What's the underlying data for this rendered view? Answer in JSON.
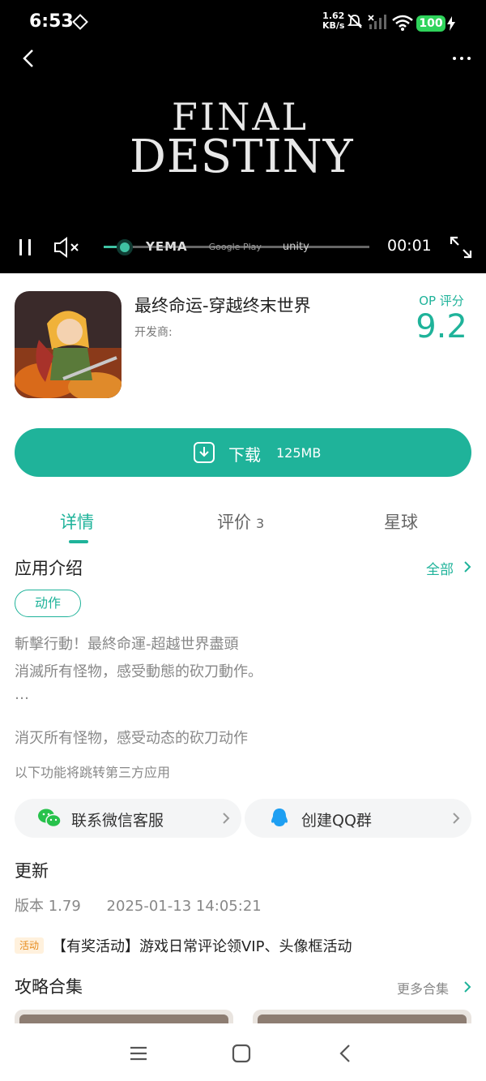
{
  "status_bar": {
    "time": "6:53",
    "net_speed_value": "1.62",
    "net_speed_unit": "KB/s",
    "battery": "100"
  },
  "video": {
    "logo_line1": "FINAL",
    "logo_line2": "DESTINY",
    "brands": [
      "YEMA",
      "Google Play",
      "unity"
    ],
    "current_time": "00:01",
    "progress_fraction": 0.08
  },
  "app": {
    "title": "最终命运-穿越终末世界",
    "developer_label": "开发商:",
    "score_label": "OP 评分",
    "score": "9.2"
  },
  "download": {
    "label": "下载",
    "size": "125MB"
  },
  "tabs": [
    {
      "label": "详情",
      "count": ""
    },
    {
      "label": "评价",
      "count": "3"
    },
    {
      "label": "星球",
      "count": ""
    }
  ],
  "intro": {
    "title": "应用介绍",
    "all_link": "全部",
    "tag": "动作",
    "lines": [
      "斬擊行動！最終命運-超越世界盡頭",
      "消滅所有怪物，感受動態的砍刀動作。",
      "…"
    ],
    "summary": "消灭所有怪物，感受动态的砍刀动作",
    "third_party_note": "以下功能将跳转第三方应用"
  },
  "services": [
    {
      "label": "联系微信客服",
      "icon": "wechat-icon"
    },
    {
      "label": "创建QQ群",
      "icon": "qq-icon"
    }
  ],
  "update": {
    "title": "更新",
    "version": "版本 1.79",
    "date": "2025-01-13 14:05:21"
  },
  "activity": {
    "badge": "活动",
    "text": "【有奖活动】游戏日常评论领VIP、头像框活动"
  },
  "guides": {
    "title": "攻略合集",
    "more": "更多合集"
  },
  "colors": {
    "accent": "#1fb39a",
    "battery": "#2fd35b"
  }
}
